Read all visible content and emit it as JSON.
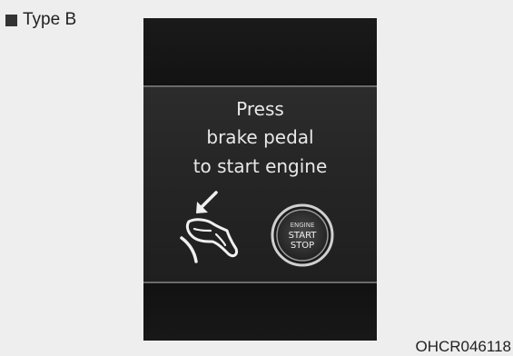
{
  "type_label": "Type B",
  "display": {
    "line1": "Press",
    "line2": "brake pedal",
    "line3": "to start engine",
    "button": {
      "line1": "ENGINE",
      "line2": "START",
      "line3": "STOP"
    }
  },
  "figure_code": "OHCR046118",
  "icons": [
    "brake-pedal-icon",
    "arrow-icon",
    "engine-start-stop-button-icon"
  ],
  "colors": {
    "background": "#efeeee",
    "display_bg": "#101010",
    "panel_bg": "#262626",
    "text": "#e8e8e8"
  }
}
